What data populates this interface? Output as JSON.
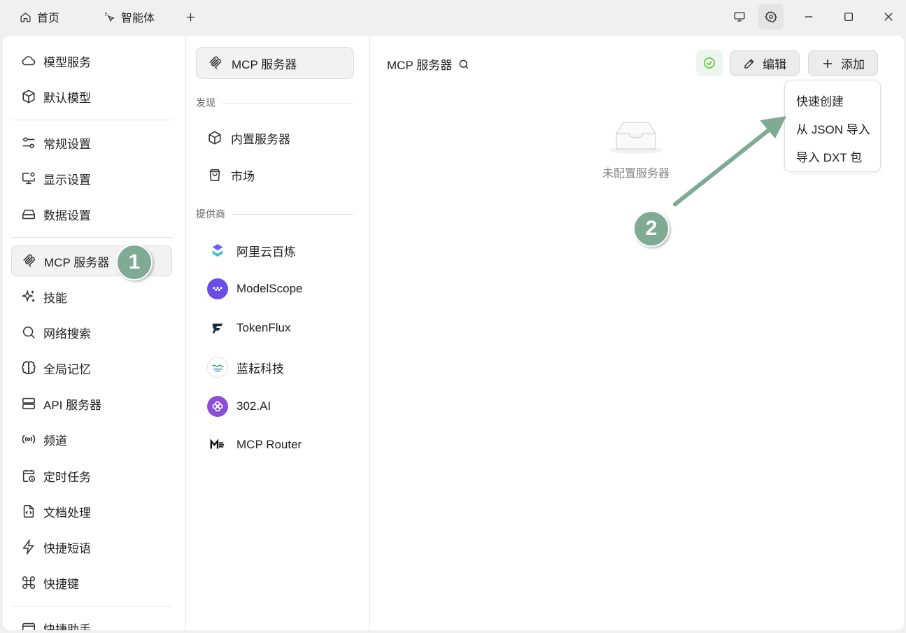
{
  "titlebar": {
    "tabs": [
      {
        "label": "首页",
        "icon": "home-icon"
      },
      {
        "label": "智能体",
        "icon": "sparkle-cursor-icon"
      }
    ],
    "add_tab_icon": "plus-icon",
    "buttons": [
      "monitor-icon",
      "gear-icon",
      "minimize-icon",
      "maximize-icon",
      "close-icon"
    ]
  },
  "sidebar": {
    "items": [
      {
        "label": "模型服务",
        "icon": "cloud-icon"
      },
      {
        "label": "默认模型",
        "icon": "cube-icon"
      },
      {
        "label": "常规设置",
        "icon": "sliders-icon"
      },
      {
        "label": "显示设置",
        "icon": "monitor-gear-icon"
      },
      {
        "label": "数据设置",
        "icon": "hard-drive-icon"
      },
      {
        "label": "MCP 服务器",
        "icon": "mcp-icon"
      },
      {
        "label": "技能",
        "icon": "sparkles-icon"
      },
      {
        "label": "网络搜索",
        "icon": "search-icon"
      },
      {
        "label": "全局记忆",
        "icon": "brain-icon"
      },
      {
        "label": "API 服务器",
        "icon": "server-icon"
      },
      {
        "label": "频道",
        "icon": "radio-icon"
      },
      {
        "label": "定时任务",
        "icon": "calendar-clock-icon"
      },
      {
        "label": "文档处理",
        "icon": "file-code-icon"
      },
      {
        "label": "快捷短语",
        "icon": "zap-icon"
      },
      {
        "label": "快捷键",
        "icon": "command-icon"
      },
      {
        "label": "快捷助手",
        "icon": "assistant-icon"
      }
    ],
    "active_index": 5
  },
  "mcp_panel": {
    "header": "MCP 服务器",
    "discover_label": "发现",
    "discover_items": [
      {
        "label": "内置服务器",
        "icon": "cube-icon"
      },
      {
        "label": "市场",
        "icon": "shopping-bag-icon"
      }
    ],
    "providers_label": "提供商",
    "providers": [
      {
        "label": "阿里云百炼",
        "icon": "bailian-logo-icon"
      },
      {
        "label": "ModelScope",
        "icon": "modelscope-logo-icon"
      },
      {
        "label": "TokenFlux",
        "icon": "tokenflux-logo-icon"
      },
      {
        "label": "蓝耘科技",
        "icon": "lanyun-logo-icon"
      },
      {
        "label": "302.AI",
        "icon": "302ai-logo-icon"
      },
      {
        "label": "MCP Router",
        "icon": "mcp-router-logo-icon"
      }
    ]
  },
  "content": {
    "title": "MCP 服务器",
    "edit_label": "编辑",
    "add_label": "添加",
    "empty_text": "未配置服务器",
    "dropdown": [
      "快速创建",
      "从 JSON 导入",
      "导入 DXT 包"
    ],
    "status_color": "#52c41a"
  },
  "annotations": {
    "badge1": "1",
    "badge2": "2",
    "color": "#7fab95"
  },
  "colors": {
    "accent_annotation": "#7fab95",
    "active_bg": "#f2f2f2"
  }
}
